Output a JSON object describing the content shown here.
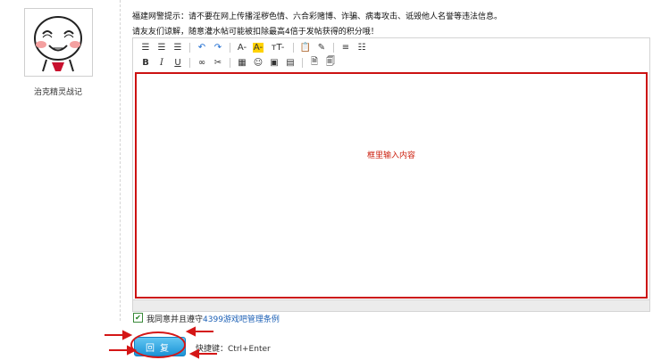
{
  "user": {
    "name": "治克精灵战记"
  },
  "notices": {
    "line1": "福建网警提示：请不要在网上传播淫秽色情、六合彩赌博、诈骗、病毒攻击、诋毁他人名誉等违法信息。",
    "line2": "请友友们谅解，随意灌水帖可能被扣除最高4倍于发帖获得的积分哦！"
  },
  "toolbar": {
    "row1": [
      {
        "icon": "align-left-icon",
        "glyph": "☰"
      },
      {
        "icon": "align-center-icon",
        "glyph": "☰"
      },
      {
        "icon": "align-right-icon",
        "glyph": "☰"
      },
      {
        "icon": "undo-icon",
        "glyph": "↶"
      },
      {
        "icon": "redo-icon",
        "glyph": "↷"
      },
      {
        "icon": "font-size-icon",
        "glyph": "A-"
      },
      {
        "icon": "font-color-icon",
        "glyph": "A-"
      },
      {
        "icon": "text-size-icon",
        "glyph": "тT-"
      },
      {
        "icon": "paste-icon",
        "glyph": "📋"
      },
      {
        "icon": "clear-format-icon",
        "glyph": "✎"
      },
      {
        "icon": "ordered-list-icon",
        "glyph": "≡"
      },
      {
        "icon": "unordered-list-icon",
        "glyph": "☷"
      }
    ],
    "row2": [
      {
        "icon": "bold-icon",
        "glyph": "B"
      },
      {
        "icon": "italic-icon",
        "glyph": "I"
      },
      {
        "icon": "underline-icon",
        "glyph": "U"
      },
      {
        "icon": "link-icon",
        "glyph": "∞"
      },
      {
        "icon": "unlink-icon",
        "glyph": "✂"
      },
      {
        "icon": "table-icon",
        "glyph": "▦"
      },
      {
        "icon": "emoji-icon",
        "glyph": "☺"
      },
      {
        "icon": "image-icon",
        "glyph": "▣"
      },
      {
        "icon": "video-icon",
        "glyph": "▤"
      },
      {
        "icon": "preview-icon",
        "glyph": "🗎"
      },
      {
        "icon": "draft-icon",
        "glyph": "🗐"
      }
    ]
  },
  "editor": {
    "content_hint": "框里输入内容"
  },
  "agree": {
    "checked": true,
    "text_prefix": "我同意并且遵守",
    "link_text": "4399游戏吧管理条例"
  },
  "reply": {
    "button_label": "回复",
    "shortcut_label": "快捷键：Ctrl+Enter"
  },
  "colors": {
    "annotation_red": "#d41616",
    "button_blue": "#1b93d6",
    "link_blue": "#1b5fb5"
  }
}
